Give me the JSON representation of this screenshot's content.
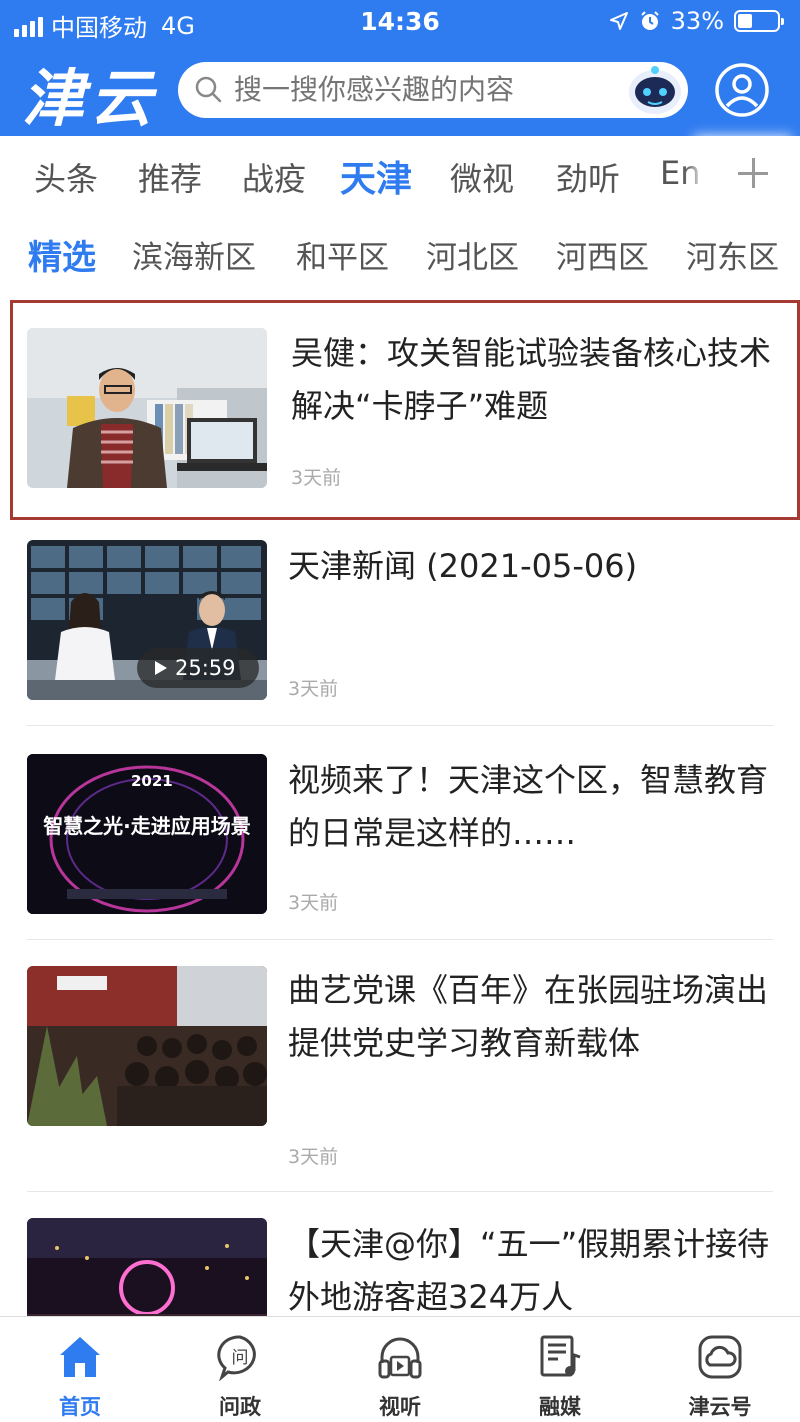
{
  "status_bar": {
    "carrier": "中国移动",
    "network": "4G",
    "time": "14:36",
    "battery": "33%",
    "battery_level": 0.33
  },
  "header": {
    "logo": "津云",
    "search_placeholder": "搜一搜你感兴趣的内容"
  },
  "channels": [
    {
      "label": "头条"
    },
    {
      "label": "推荐"
    },
    {
      "label": "战疫"
    },
    {
      "label": "天津",
      "active": true
    },
    {
      "label": "微视"
    },
    {
      "label": "劲听"
    },
    {
      "label": "En"
    }
  ],
  "districts": [
    {
      "label": "精选",
      "active": true
    },
    {
      "label": "滨海新区"
    },
    {
      "label": "和平区"
    },
    {
      "label": "河北区"
    },
    {
      "label": "河西区"
    },
    {
      "label": "河东区"
    }
  ],
  "feed": [
    {
      "title": "吴健：攻关智能试验装备核心技术 解决“卡脖子”难题",
      "time": "3天前"
    },
    {
      "title": "天津新闻 (2021-05-06)",
      "time": "3天前",
      "duration": "25:59"
    },
    {
      "title": "视频来了！天津这个区，智慧教育的日常是这样的……",
      "time": "3天前",
      "thumb_text": "智慧之光·走进应用场景",
      "thumb_year": "2021"
    },
    {
      "title": "曲艺党课《百年》在张园驻场演出 提供党史学习教育新载体",
      "time": "3天前"
    },
    {
      "title": "【天津@你】“五一”假期累计接待外地游客超324万人",
      "time": ""
    }
  ],
  "bottom_nav": [
    {
      "label": "首页",
      "icon": "home-icon",
      "active": true
    },
    {
      "label": "问政",
      "icon": "ask-icon"
    },
    {
      "label": "视听",
      "icon": "headphones-icon"
    },
    {
      "label": "融媒",
      "icon": "media-icon"
    },
    {
      "label": "津云号",
      "icon": "cloud-icon"
    }
  ],
  "colors": {
    "brand": "#2f7bf0",
    "selection_border": "#a53a33"
  }
}
